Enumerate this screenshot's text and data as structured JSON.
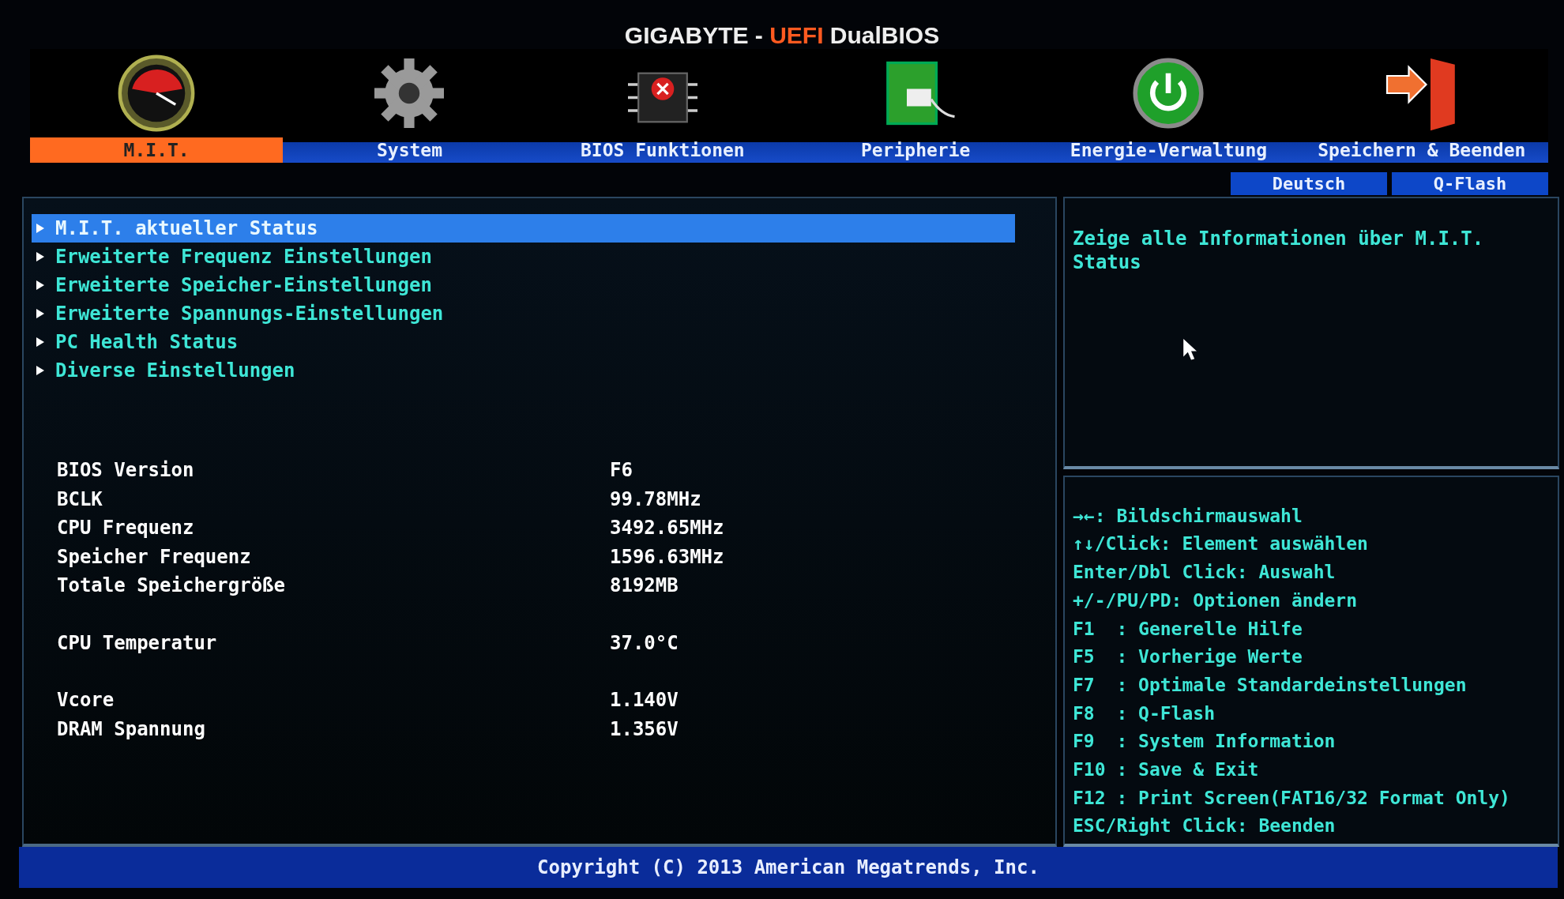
{
  "header": {
    "brand": "GIGABYTE",
    "separator": "-",
    "highlight": "UEFI",
    "product": "DualBIOS"
  },
  "tabs": [
    {
      "label": "M.I.T.",
      "selected": true
    },
    {
      "label": "System",
      "selected": false
    },
    {
      "label": "BIOS Funktionen",
      "selected": false
    },
    {
      "label": "Peripherie",
      "selected": false
    },
    {
      "label": "Energie-Verwaltung",
      "selected": false
    },
    {
      "label": "Speichern & Beenden",
      "selected": false
    }
  ],
  "top_buttons": [
    "Deutsch",
    "Q-Flash"
  ],
  "menu": [
    {
      "label": "M.I.T. aktueller Status",
      "selected": true
    },
    {
      "label": "Erweiterte Frequenz Einstellungen",
      "selected": false
    },
    {
      "label": "Erweiterte Speicher-Einstellungen",
      "selected": false
    },
    {
      "label": "Erweiterte Spannungs-Einstellungen",
      "selected": false
    },
    {
      "label": "PC Health Status",
      "selected": false
    },
    {
      "label": "Diverse Einstellungen",
      "selected": false
    }
  ],
  "info_groups": [
    [
      {
        "label": "BIOS Version",
        "value": "F6"
      },
      {
        "label": "BCLK",
        "value": "99.78MHz"
      },
      {
        "label": "CPU Frequenz",
        "value": "3492.65MHz"
      },
      {
        "label": "Speicher Frequenz",
        "value": "1596.63MHz"
      },
      {
        "label": "Totale Speichergröße",
        "value": "8192MB"
      }
    ],
    [
      {
        "label": "CPU Temperatur",
        "value": "37.0°C"
      }
    ],
    [
      {
        "label": "Vcore",
        "value": "1.140V"
      },
      {
        "label": "DRAM Spannung",
        "value": "1.356V"
      }
    ]
  ],
  "help_text": "Zeige alle Informationen über M.I.T. Status",
  "key_help": [
    "→←: Bildschirmauswahl",
    "↑↓/Click: Element auswählen",
    "Enter/Dbl Click: Auswahl",
    "+/-/PU/PD: Optionen ändern",
    "F1  : Generelle Hilfe",
    "F5  : Vorherige Werte",
    "F7  : Optimale Standardeinstellungen",
    "F8  : Q-Flash",
    "F9  : System Information",
    "F10 : Save & Exit",
    "F12 : Print Screen(FAT16/32 Format Only)",
    "ESC/Right Click: Beenden"
  ],
  "footer": "Copyright (C) 2013 American Megatrends, Inc."
}
